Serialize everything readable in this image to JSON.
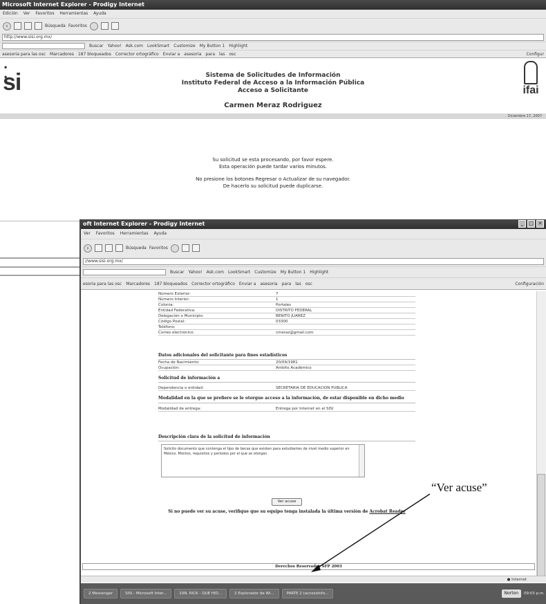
{
  "back_window": {
    "title": "Microsoft Internet Explorer - Prodigy Internet",
    "menu": [
      "Edición",
      "Ver",
      "Favoritos",
      "Herramientas",
      "Ayuda"
    ],
    "toolbar": {
      "search": "Búsqueda",
      "favorites": "Favoritos"
    },
    "address": "http://www.sisi.org.mx/",
    "links": [
      "Buscar",
      "Yahoo!",
      "Ask.com",
      "LookSmart",
      "Customize",
      "My Button 1",
      "Highlight"
    ],
    "favbar": "asesoria para las osc",
    "favbar_items": [
      "Marcadores",
      "187 bloqueados",
      "Corrector ortográfico",
      "Enviar a",
      "asesoria",
      "para",
      "las",
      "osc"
    ],
    "favbar_config": "Configur",
    "logo_left": "si",
    "logo_right": "ifai",
    "header_line1": "Sistema de Solicitudes de Información",
    "header_line2": "Instituto Federal de Acceso a la Información Pública",
    "header_line3": "Acceso a Solicitante",
    "user": "Carmen Meraz Rodriguez",
    "date": "Diciembre 17, 2007",
    "msg1": "Su solicitud se esta procesando, por favor espere.",
    "msg2": "Esta operación puede tardar varios minutos.",
    "msg3": "No presione los botones Regresar o Actualizar de su navegador.",
    "msg4": "De hacerlo su solicitud puede duplicarse."
  },
  "front_window": {
    "title": "oft Internet Explorer - Prodigy Internet",
    "menu": [
      "Ver",
      "Favoritos",
      "Herramientas",
      "Ayuda"
    ],
    "address": "//www.sisi.org.mx/",
    "favbar": "esoria para las osc",
    "config": "Configuración",
    "fields": [
      {
        "k": "Número Exterior:",
        "v": "7"
      },
      {
        "k": "Número Interior:",
        "v": "1"
      },
      {
        "k": "Colonia:",
        "v": "Portales"
      },
      {
        "k": "Entidad Federativa:",
        "v": "DISTRITO FEDERAL"
      },
      {
        "k": "Delegación o Municipio:",
        "v": "BENITO JUAREZ"
      },
      {
        "k": "Código Postal:",
        "v": "03300"
      },
      {
        "k": "Teléfono:",
        "v": ""
      },
      {
        "k": "Correo electrónico:",
        "v": "cmeraz@gmail.com"
      }
    ],
    "section_stats": "Datos adicionales del solicitante para fines estadísticos",
    "stats_fields": [
      {
        "k": "Fecha de Nacimiento:",
        "v": "20/09/1981"
      },
      {
        "k": "Ocupación:",
        "v": "Ámbito Académico"
      }
    ],
    "section_solicitud": "Solicitud de información a",
    "solicitud_fields": [
      {
        "k": "Dependencia o entidad:",
        "v": "SECRETARÍA DE EDUCACIÓN PÚBLICA"
      }
    ],
    "section_modalidad": "Modalidad en la que se prefiere se le otorgue acceso a la información, de estar disponible en dicho medio",
    "modalidad_fields": [
      {
        "k": "Modalidad de entrega:",
        "v": "Entrega por Internet en el SISI"
      }
    ],
    "section_desc": "Descripción clara de la solicitud de información",
    "description": "Solicito documento que contenga el tipo de becas que existen para estudiantes de nivel medio superior en México. Montos, requisitos y periodos por el que se otorgan.",
    "button": "Ver acuse",
    "acrobat_text": "Si no puede ver su acuse, verifique que su equipo tenga instalada la última versión de",
    "acrobat_link": "Acrobat Reader",
    "footer": "Derechos Reservados SFP 2003",
    "status": "Internet",
    "taskbar": [
      "2 Messenger",
      "SISI - Microsoft Inter...",
      "10N. RICK - QUE HID...",
      "2 Explorador de Wi...",
      "PARTE 2 (accesoInfo...",
      "Norton",
      "09:03 p.m."
    ]
  },
  "annotation": "“Ver acuse”"
}
